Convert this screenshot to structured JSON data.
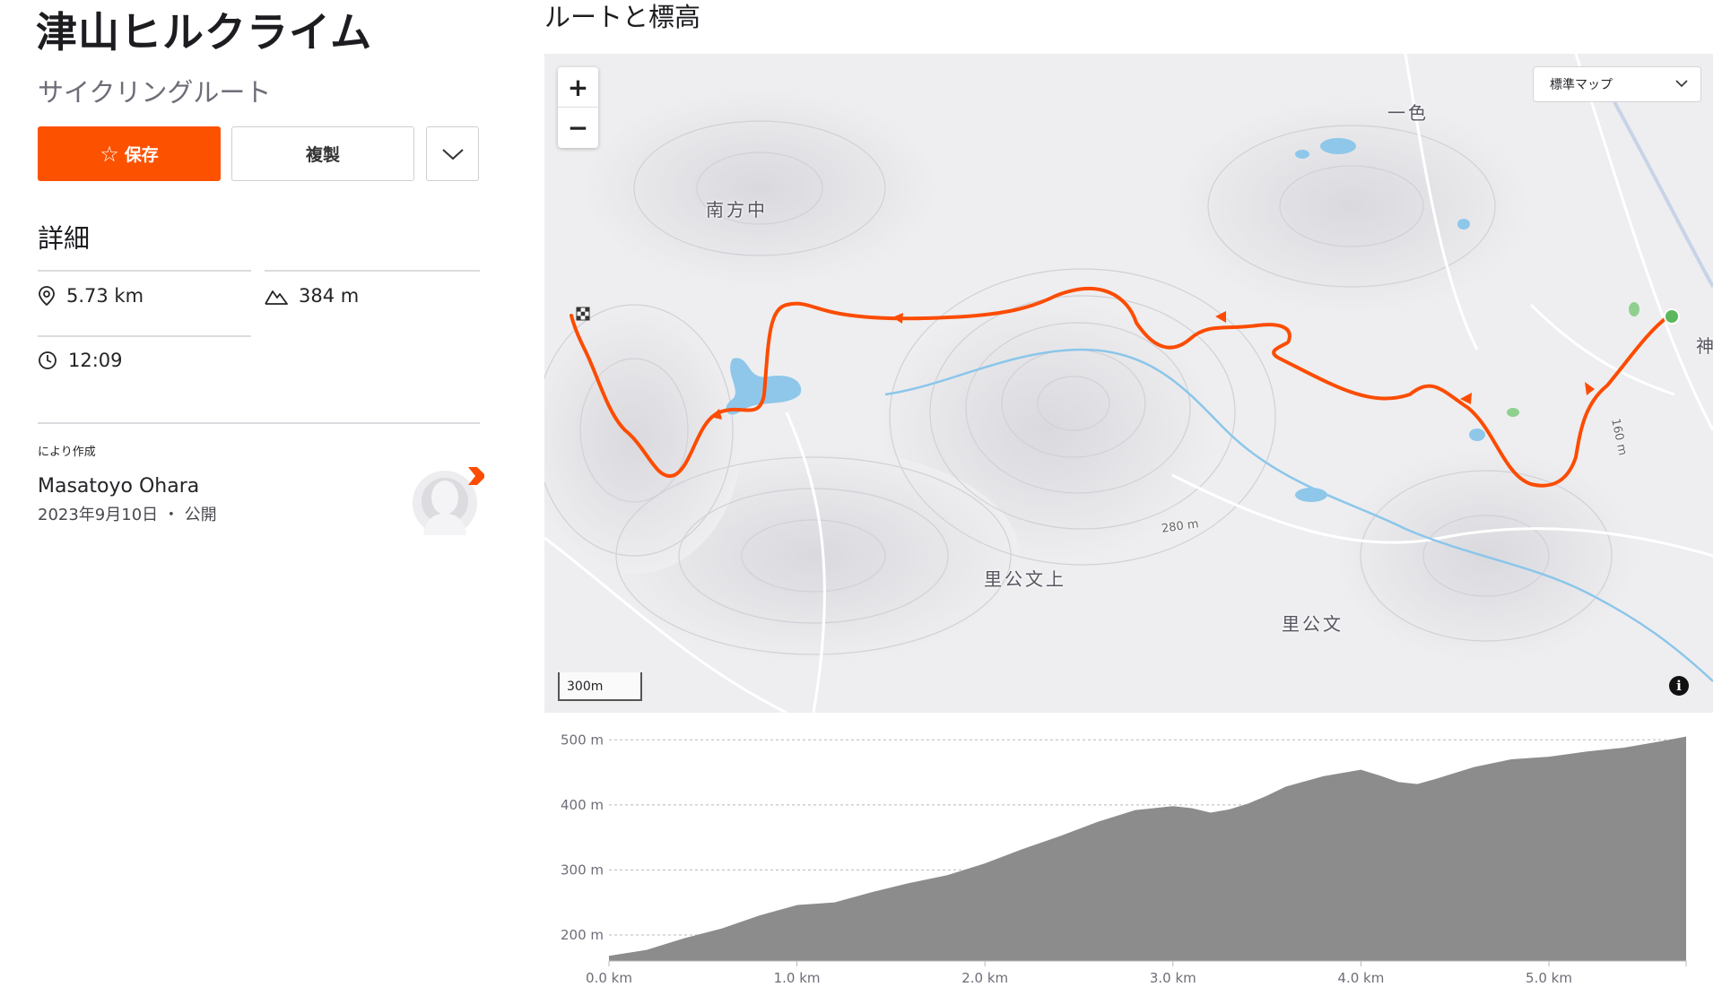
{
  "route": {
    "title": "津山ヒルクライム",
    "subtitle": "サイクリングルート",
    "save_label": "保存",
    "copy_label": "複製"
  },
  "details": {
    "heading": "詳細",
    "distance": "5.73 km",
    "elevation_gain": "384 m",
    "time": "12:09"
  },
  "creator": {
    "label": "により作成",
    "name": "Masatoyo Ohara",
    "date_visibility": "2023年9月10日 ・ 公開"
  },
  "map": {
    "section_title": "ルートと標高",
    "map_type": "標準マップ",
    "scale": "300m",
    "info_symbol": "i",
    "zoom_in": "+",
    "zoom_out": "−",
    "places": [
      "南方中",
      "一色",
      "里公文上",
      "里公文",
      "神"
    ],
    "contour_labels": [
      "280 m",
      "160 m"
    ],
    "route_color": "#fc4c02",
    "start_color": "#5cb85c"
  },
  "chart_data": {
    "type": "area",
    "xlabel": "",
    "ylabel": "",
    "x_ticks": [
      "0.0 km",
      "1.0 km",
      "2.0 km",
      "3.0 km",
      "4.0 km",
      "5.0 km"
    ],
    "y_ticks": [
      "200 m",
      "300 m",
      "400 m",
      "500 m"
    ],
    "xlim": [
      0,
      5.73
    ],
    "ylim": [
      160,
      510
    ],
    "fill_color": "#8c8c8c",
    "series": [
      {
        "x": [
          0,
          0.2,
          0.4,
          0.6,
          0.8,
          1.0,
          1.1,
          1.2,
          1.4,
          1.6,
          1.8,
          2.0,
          2.2,
          2.4,
          2.6,
          2.8,
          3.0,
          3.1,
          3.2,
          3.3,
          3.4,
          3.5,
          3.6,
          3.8,
          4.0,
          4.1,
          4.2,
          4.3,
          4.4,
          4.6,
          4.8,
          5.0,
          5.2,
          5.4,
          5.6,
          5.73
        ],
        "y": [
          168,
          177,
          195,
          210,
          230,
          246,
          248,
          250,
          266,
          280,
          292,
          310,
          332,
          352,
          374,
          392,
          398,
          395,
          388,
          393,
          402,
          414,
          428,
          444,
          454,
          445,
          435,
          432,
          440,
          458,
          470,
          474,
          482,
          488,
          498,
          505
        ]
      }
    ]
  }
}
